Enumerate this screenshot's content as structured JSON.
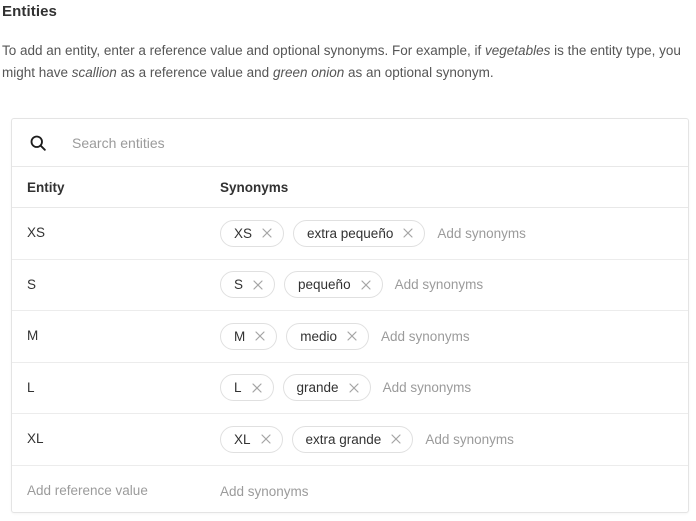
{
  "header": {
    "title": "Entities",
    "description_parts": [
      {
        "text": "To add an entity, enter a reference value and optional synonyms. For example, if ",
        "italic": false
      },
      {
        "text": "vegetables",
        "italic": true
      },
      {
        "text": " is the entity type, you might have ",
        "italic": false
      },
      {
        "text": "scallion",
        "italic": true
      },
      {
        "text": " as a reference value and ",
        "italic": false
      },
      {
        "text": "green onion",
        "italic": true
      },
      {
        "text": " as an optional synonym.",
        "italic": false
      }
    ],
    "description_plain": "To add an entity, enter a reference value and optional synonyms. For example, if vegetables is the entity type, you might have scallion as a reference value and green onion as an optional synonym."
  },
  "search": {
    "icon": "search-icon",
    "placeholder": "Search entities",
    "value": ""
  },
  "table": {
    "columns": {
      "entity": "Entity",
      "synonyms": "Synonyms"
    },
    "add_synonyms_placeholder": "Add synonyms",
    "add_reference_placeholder": "Add reference value",
    "remove_icon": "close-icon",
    "rows": [
      {
        "entity": "XS",
        "synonyms": [
          "XS",
          "extra pequeño"
        ]
      },
      {
        "entity": "S",
        "synonyms": [
          "S",
          "pequeño"
        ]
      },
      {
        "entity": "M",
        "synonyms": [
          "M",
          "medio"
        ]
      },
      {
        "entity": "L",
        "synonyms": [
          "L",
          "grande"
        ]
      },
      {
        "entity": "XL",
        "synonyms": [
          "XL",
          "extra grande"
        ]
      }
    ]
  },
  "colors": {
    "text_primary": "#323232",
    "text_secondary": "#565656",
    "text_placeholder": "#9b9b9b",
    "border": "#e4e4e4",
    "row_divider": "#ececec",
    "chip_border": "#e0e0e0",
    "background": "#ffffff"
  }
}
